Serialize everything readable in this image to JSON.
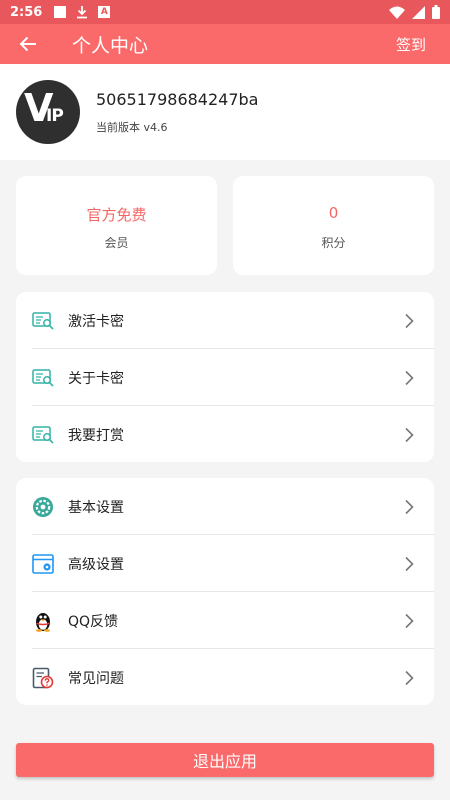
{
  "statusbar": {
    "time": "2:56",
    "a_glyph": "A"
  },
  "appbar": {
    "title": "个人中心",
    "signin_label": "签到"
  },
  "profile": {
    "avatar_v": "V",
    "avatar_ip": "IP",
    "user_id": "50651798684247ba",
    "version": "当前版本 v4.6"
  },
  "stats": [
    {
      "value": "官方免费",
      "label": "会员"
    },
    {
      "value": "0",
      "label": "积分"
    }
  ],
  "menu_group1": [
    {
      "label": "激活卡密",
      "icon": "card-key-icon"
    },
    {
      "label": "关于卡密",
      "icon": "card-key-icon"
    },
    {
      "label": "我要打赏",
      "icon": "card-key-icon"
    }
  ],
  "menu_group2": [
    {
      "label": "基本设置",
      "icon": "gear-icon"
    },
    {
      "label": "高级设置",
      "icon": "window-gear-icon"
    },
    {
      "label": "QQ反馈",
      "icon": "qq-penguin-icon"
    },
    {
      "label": "常见问题",
      "icon": "help-document-icon"
    }
  ],
  "logout_label": "退出应用",
  "colors": {
    "accent": "#fa6a6a",
    "statusbar": "#e8575c",
    "stat_value": "#f56565",
    "teal_icon": "#33b3a6",
    "blue_icon": "#2196f3"
  }
}
